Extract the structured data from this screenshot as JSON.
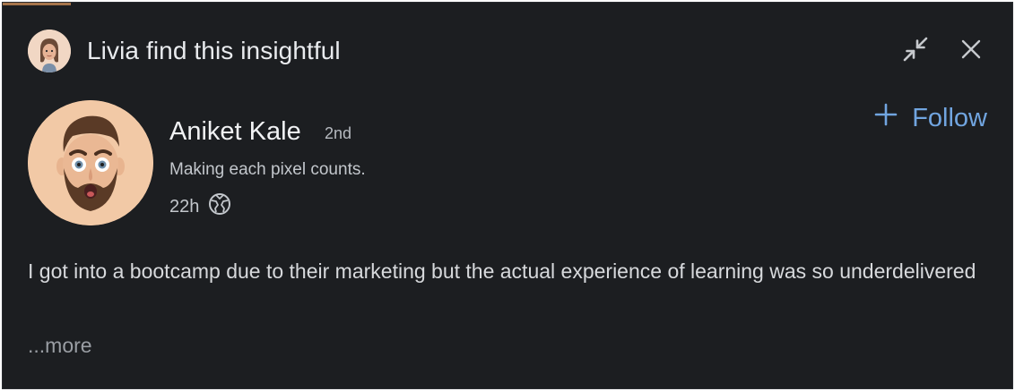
{
  "notification": {
    "text": "Livia find this insightful"
  },
  "author": {
    "name": "Aniket Kale",
    "degree": "2nd",
    "headline": "Making each pixel counts.",
    "time": "22h"
  },
  "actions": {
    "follow_label": "Follow",
    "follow_icon": "plus-icon",
    "collapse_icon": "collapse-icon",
    "close_icon": "close-icon"
  },
  "post": {
    "text": "I got into a bootcamp due to their marketing but the actual experience of learning was so underdelivered",
    "more_label": "...more"
  },
  "colors": {
    "background": "#1c1e21",
    "accent": "#71a5e0"
  }
}
